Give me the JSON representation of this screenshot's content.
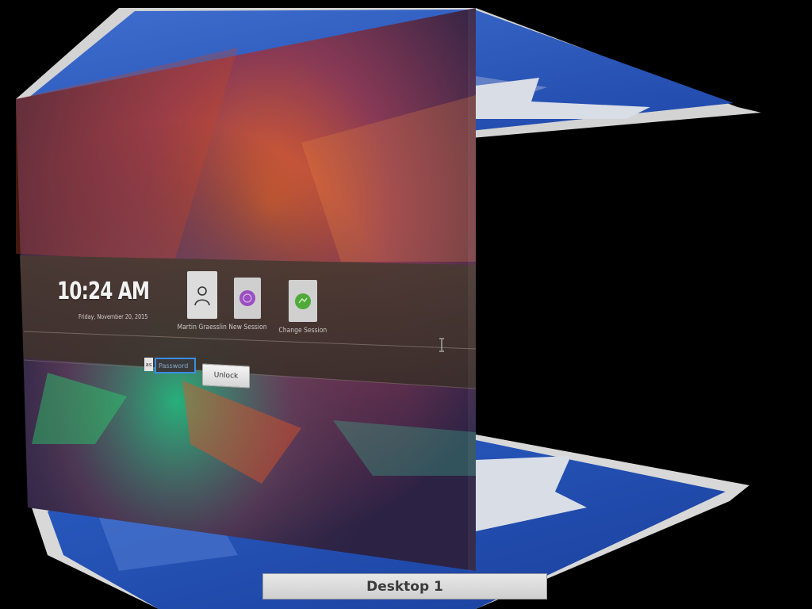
{
  "lockscreen": {
    "time": "10:24 AM",
    "date": "Friday, November 20, 2015",
    "sessions": [
      {
        "label": "Martin Graesslin",
        "icon": "user-icon"
      },
      {
        "label": "New Session",
        "icon": "new-session-icon"
      },
      {
        "label": "Change Session",
        "icon": "change-session-icon"
      }
    ],
    "as_label": "as",
    "password_placeholder": "Password",
    "unlock_label": "Unlock"
  },
  "desktop": {
    "label": "Desktop 1"
  },
  "colors": {
    "kde_blue": "#2a56b5",
    "wallpaper_orange": "#e5672a",
    "wallpaper_purple": "#4a2a55",
    "wallpaper_green": "#2aa070",
    "accent": "#3d8ee0"
  }
}
